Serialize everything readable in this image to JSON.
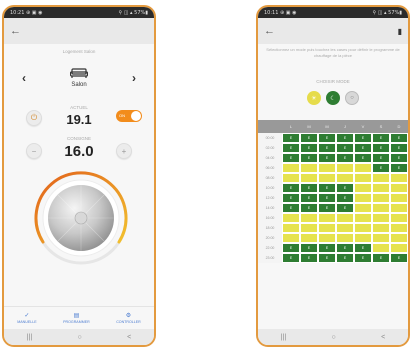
{
  "colors": {
    "accent": "#e39a3f",
    "comfort": "#e6e34e",
    "eco": "#2e7d32",
    "off": "#d8d8d8",
    "tab_text": "#4a7bd0"
  },
  "phone1": {
    "status_left": "10:21 ⊕ ▣ ◉",
    "status_right": "⚲ ◫ ▴ 57%▮",
    "back_icon": "back-arrow-icon",
    "legend": "Logement Salon",
    "prev_icon": "chevron-left-icon",
    "next_icon": "chevron-right-icon",
    "room_icon": "sofa-icon",
    "room_name": "Salon",
    "power_icon": "power-icon",
    "actual_label": "ACTUEL",
    "actual_value": "19.1",
    "toggle_label": "ON",
    "toggle_on": true,
    "minus_label": "−",
    "target_label": "CONSIGNE",
    "target_value": "16.0",
    "plus_label": "+",
    "tabs": [
      {
        "icon": "thermometer-icon",
        "label": "MANUELLE"
      },
      {
        "icon": "calendar-icon",
        "label": "PROGRAMMER"
      },
      {
        "icon": "settings-icon",
        "label": "CONTROLLER"
      }
    ],
    "nav": [
      "|||",
      "○",
      "<"
    ]
  },
  "phone2": {
    "status_left": "10:11 ⊕ ▣ ◉",
    "status_right": "⚲ ◫ ▴ 57%▮",
    "back_icon": "back-arrow-icon",
    "trash_icon": "trash-icon",
    "info": "Sélectionnez un mode puis touchez les cases pour définir le programme de chauffage de la pièce",
    "modes_label": "CHOISIR MODE",
    "modes": [
      {
        "type": "comfort",
        "icon": "sun-icon",
        "glyph": "☀"
      },
      {
        "type": "eco",
        "icon": "moon-icon",
        "glyph": "☾"
      },
      {
        "type": "off",
        "icon": "off-icon",
        "glyph": "○"
      }
    ],
    "days": [
      "L",
      "M",
      "M",
      "J",
      "V",
      "S",
      "D"
    ],
    "cell_labels": {
      "E": "E",
      "C": ""
    },
    "schedule": [
      {
        "time": "00:00",
        "cells": [
          "E",
          "E",
          "E",
          "E",
          "E",
          "E",
          "E"
        ]
      },
      {
        "time": "02:00",
        "cells": [
          "E",
          "E",
          "E",
          "E",
          "E",
          "E",
          "E"
        ]
      },
      {
        "time": "04:00",
        "cells": [
          "E",
          "E",
          "E",
          "E",
          "E",
          "E",
          "E"
        ]
      },
      {
        "time": "06:00",
        "cells": [
          "C",
          "C",
          "C",
          "C",
          "C",
          "E",
          "E"
        ]
      },
      {
        "time": "08:00",
        "cells": [
          "C",
          "C",
          "C",
          "C",
          "C",
          "C",
          "C"
        ]
      },
      {
        "time": "10:00",
        "cells": [
          "E",
          "E",
          "E",
          "E",
          "C",
          "C",
          "C"
        ]
      },
      {
        "time": "12:00",
        "cells": [
          "E",
          "E",
          "E",
          "E",
          "C",
          "C",
          "C"
        ]
      },
      {
        "time": "14:00",
        "cells": [
          "E",
          "E",
          "E",
          "E",
          "C",
          "C",
          "C"
        ]
      },
      {
        "time": "16:00",
        "cells": [
          "C",
          "C",
          "C",
          "C",
          "C",
          "C",
          "C"
        ]
      },
      {
        "time": "18:00",
        "cells": [
          "C",
          "C",
          "C",
          "C",
          "C",
          "C",
          "C"
        ]
      },
      {
        "time": "20:00",
        "cells": [
          "C",
          "C",
          "C",
          "C",
          "C",
          "C",
          "C"
        ]
      },
      {
        "time": "22:00",
        "cells": [
          "E",
          "E",
          "E",
          "E",
          "E",
          "C",
          "C"
        ]
      },
      {
        "time": "23:00",
        "cells": [
          "E",
          "E",
          "E",
          "E",
          "E",
          "E",
          "E"
        ]
      }
    ],
    "nav": [
      "|||",
      "○",
      "<"
    ]
  }
}
